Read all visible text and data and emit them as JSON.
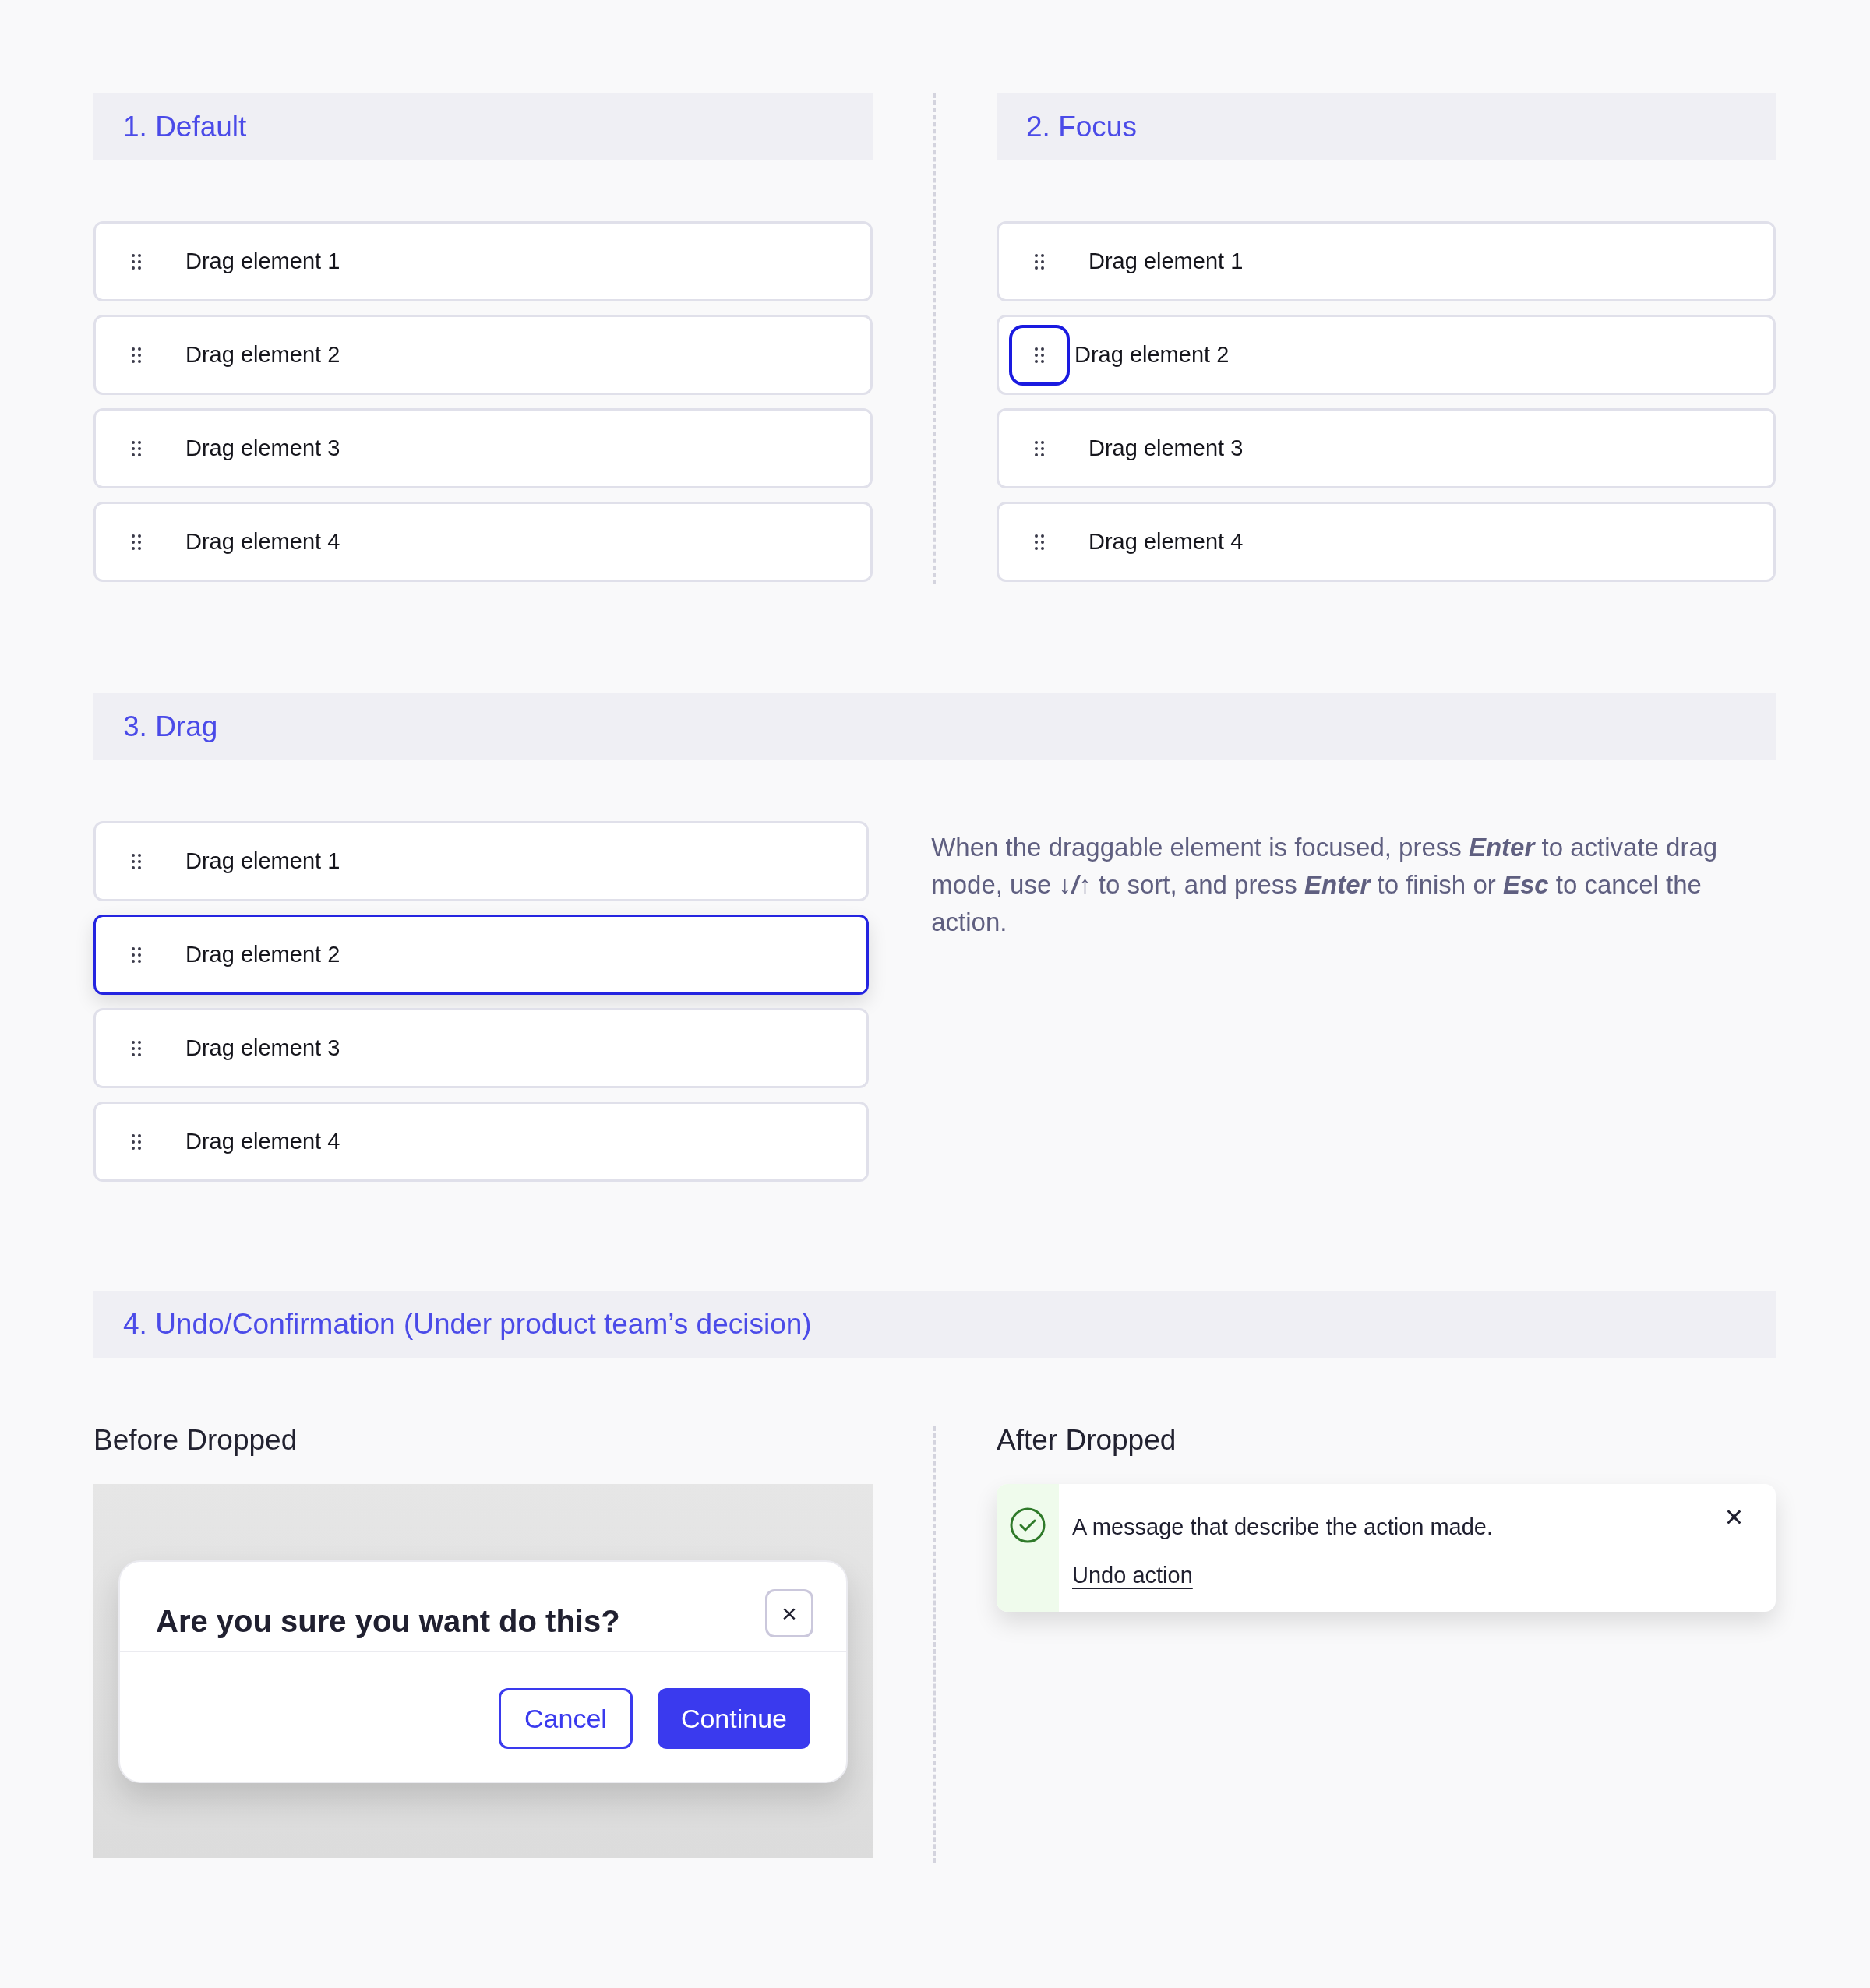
{
  "sections": [
    {
      "kind": "list",
      "title": "1. Default",
      "items": [
        {
          "label": "Drag element 1",
          "focused": false,
          "dragging": false
        },
        {
          "label": "Drag element 2",
          "focused": false,
          "dragging": false
        },
        {
          "label": "Drag element 3",
          "focused": false,
          "dragging": false
        },
        {
          "label": "Drag element 4",
          "focused": false,
          "dragging": false
        }
      ]
    },
    {
      "kind": "list",
      "title": "2. Focus",
      "items": [
        {
          "label": "Drag element 1",
          "focused": false,
          "dragging": false
        },
        {
          "label": "Drag element 2",
          "focused": true,
          "dragging": false
        },
        {
          "label": "Drag element 3",
          "focused": false,
          "dragging": false
        },
        {
          "label": "Drag element 4",
          "focused": false,
          "dragging": false
        }
      ]
    },
    {
      "kind": "list",
      "title": "3. Drag",
      "items": [
        {
          "label": "Drag element 1",
          "focused": false,
          "dragging": false
        },
        {
          "label": "Drag element 2",
          "focused": false,
          "dragging": true
        },
        {
          "label": "Drag element 3",
          "focused": false,
          "dragging": false
        },
        {
          "label": "Drag element 4",
          "focused": false,
          "dragging": false
        }
      ],
      "description": "When the draggable element is focused, press **Enter** to activate drag mode, use **↓/↑** to sort, and press **Enter** to finish or **Esc** to cancel the action."
    },
    {
      "kind": "undo",
      "title": "4. Undo/Confirmation (Under product team’s decision)",
      "before": {
        "heading": "Before Dropped",
        "dialog": {
          "title": "Are you sure you want do this?",
          "close": "×",
          "buttons": [
            "Cancel",
            "Continue"
          ]
        }
      },
      "after": {
        "heading": "After Dropped",
        "toast": {
          "message": "A message that describe the action made.",
          "link": "Undo action",
          "close": "×"
        }
      }
    }
  ]
}
